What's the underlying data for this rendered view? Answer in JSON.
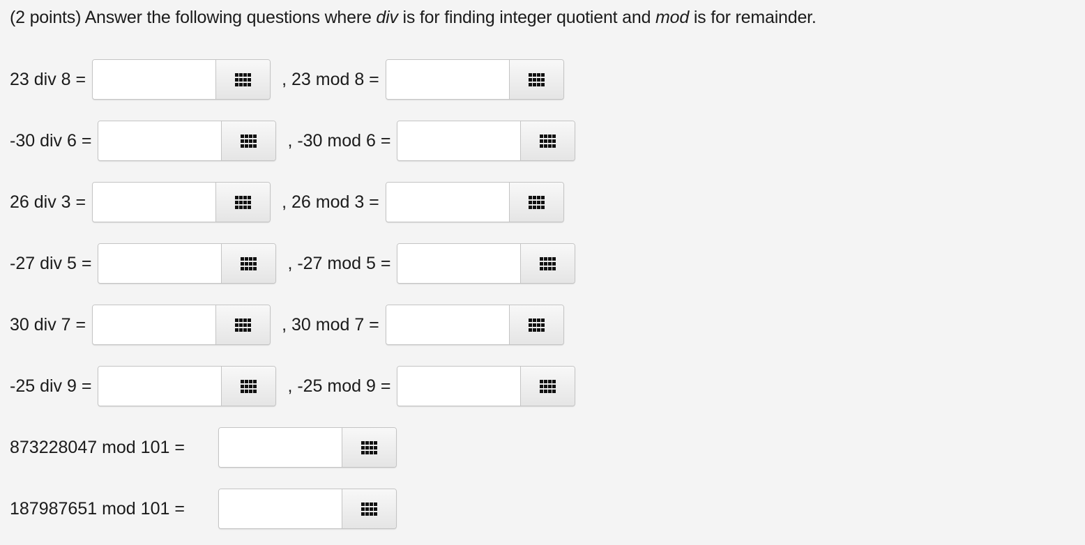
{
  "question": {
    "prefix": "(2 points) Answer the following questions where ",
    "div_word": "div",
    "middle": " is for finding integer quotient and ",
    "mod_word": "mod",
    "suffix": " is for remainder."
  },
  "rows": [
    {
      "div_label": "23 div 8 =",
      "mod_label": ", 23 mod 8 =",
      "div_value": "",
      "mod_value": ""
    },
    {
      "div_label": "-30 div 6 =",
      "mod_label": ", -30 mod 6 =",
      "div_value": "",
      "mod_value": ""
    },
    {
      "div_label": "26 div 3 =",
      "mod_label": ", 26 mod 3 =",
      "div_value": "",
      "mod_value": ""
    },
    {
      "div_label": "-27 div 5 =",
      "mod_label": ", -27 mod 5 =",
      "div_value": "",
      "mod_value": ""
    },
    {
      "div_label": "30 div 7 =",
      "mod_label": ", 30 mod 7 =",
      "div_value": "",
      "mod_value": ""
    },
    {
      "div_label": "-25 div 9 =",
      "mod_label": ", -25 mod 9 =",
      "div_value": "",
      "mod_value": ""
    }
  ],
  "big": [
    {
      "label": "873228047 mod 101 =",
      "value": ""
    },
    {
      "label": "187987651 mod 101 =",
      "value": ""
    }
  ],
  "icons": {
    "pad": "keypad-icon"
  }
}
